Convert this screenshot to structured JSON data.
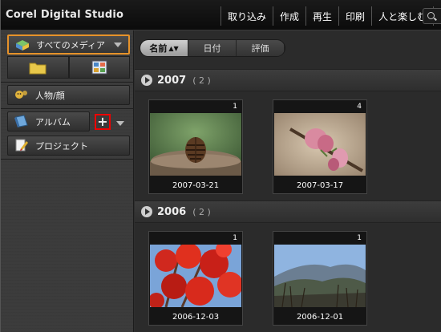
{
  "app": {
    "title": "Corel Digital Studio"
  },
  "modes": [
    {
      "label": "取り込み"
    },
    {
      "label": "作成"
    },
    {
      "label": "再生"
    },
    {
      "label": "印刷"
    },
    {
      "label": "人と楽しむ"
    }
  ],
  "sidebar": {
    "all_media_label": "すべてのメディア",
    "people_label": "人物/顔",
    "album_label": "アルバム",
    "add_symbol": "+",
    "project_label": "プロジェクト"
  },
  "sort": {
    "tabs": [
      {
        "label": "名前",
        "arrow": "▲▼"
      },
      {
        "label": "日付"
      },
      {
        "label": "評価"
      }
    ]
  },
  "groups": [
    {
      "year": "2007",
      "count": "( 2 )",
      "items": [
        {
          "number": "1",
          "date": "2007-03-21",
          "subject": "pinecone"
        },
        {
          "number": "4",
          "date": "2007-03-17",
          "subject": "pink-blossom"
        }
      ]
    },
    {
      "year": "2006",
      "count": "( 2 )",
      "items": [
        {
          "number": "1",
          "date": "2006-12-03",
          "subject": "red-maple-leaves"
        },
        {
          "number": "1",
          "date": "2006-12-01",
          "subject": "mountain-valley"
        }
      ]
    }
  ],
  "colors": {
    "selected_border": "#e6922a",
    "highlight_box": "#ee0000",
    "background": "#2b2b2b"
  }
}
